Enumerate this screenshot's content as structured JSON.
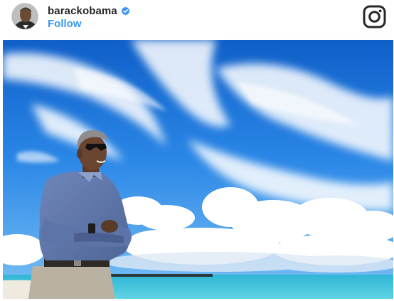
{
  "post": {
    "username": "barackobama",
    "follow_label": "Follow",
    "verified": true
  },
  "icons": {
    "avatar": "profile-avatar",
    "verified": "verified-badge-icon",
    "logo": "instagram-icon"
  },
  "colors": {
    "follow": "#3897f0",
    "verified": "#3897f0",
    "username": "#262626"
  }
}
